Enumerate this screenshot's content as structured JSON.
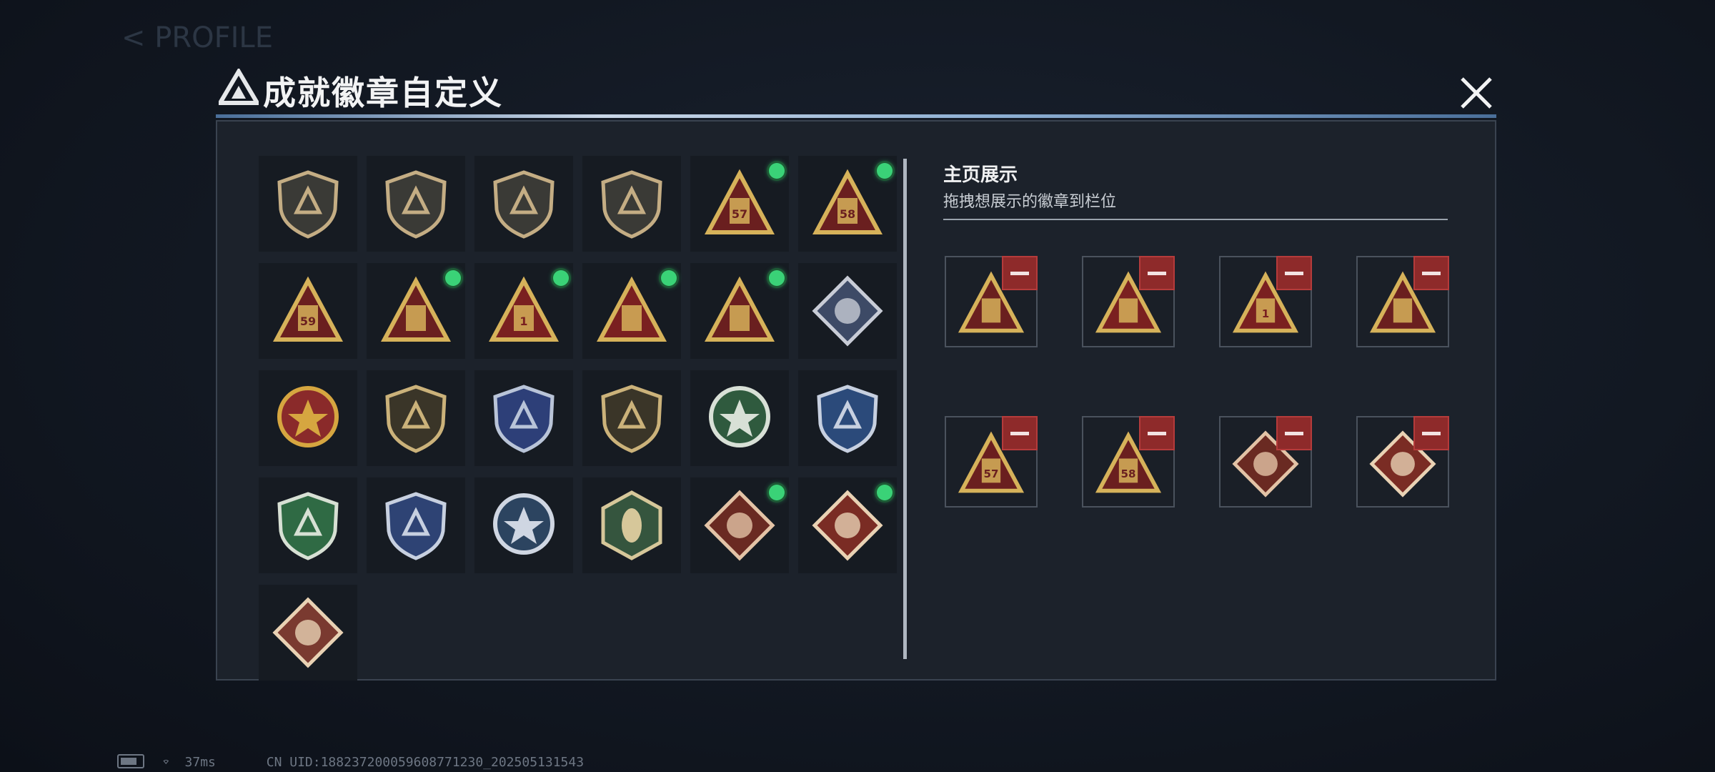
{
  "background": {
    "ghost_header": "< PROFILE"
  },
  "modal": {
    "title": "成就徽章自定义",
    "close_label": "×"
  },
  "badges": [
    {
      "name": "badge-logo-shield",
      "style": "shield",
      "color": "#c4ad84",
      "base": "#3a3a36",
      "selected": false
    },
    {
      "name": "badge-helicopter-shield",
      "style": "shield",
      "color": "#c4ad84",
      "base": "#3a3a36",
      "selected": false
    },
    {
      "name": "badge-emblem-shield",
      "style": "shield",
      "color": "#c4ad84",
      "base": "#3a3a36",
      "selected": false
    },
    {
      "name": "badge-blade-shield",
      "style": "shield",
      "color": "#c4ad84",
      "base": "#3a3a36",
      "selected": false
    },
    {
      "name": "badge-triangle-57",
      "style": "triangle",
      "color": "#d6b25a",
      "base": "#6a1f1f",
      "label": "57",
      "selected": true
    },
    {
      "name": "badge-triangle-58",
      "style": "triangle",
      "color": "#d6b25a",
      "base": "#6a1f1f",
      "label": "58",
      "selected": true
    },
    {
      "name": "badge-triangle-wings-59",
      "style": "triangle",
      "color": "#d6b25a",
      "base": "#6a1f1f",
      "label": "59",
      "selected": false
    },
    {
      "name": "badge-triangle-rockets",
      "style": "triangle",
      "color": "#d6b25a",
      "base": "#6a1f1f",
      "selected": true
    },
    {
      "name": "badge-triangle-number-1",
      "style": "triangle",
      "color": "#d6b25a",
      "base": "#7a2020",
      "label": "1",
      "selected": true
    },
    {
      "name": "badge-triangle-tower",
      "style": "triangle",
      "color": "#d6b25a",
      "base": "#7a2020",
      "selected": true
    },
    {
      "name": "badge-triangle-soldiers",
      "style": "triangle",
      "color": "#d6b25a",
      "base": "#6a1f1f",
      "selected": true
    },
    {
      "name": "badge-diamond-silver",
      "style": "diamond",
      "color": "#c8ccd6",
      "base": "#3d4a66",
      "selected": false
    },
    {
      "name": "badge-star-medal",
      "style": "circle",
      "color": "#d6a640",
      "base": "#8a2a2a",
      "selected": false
    },
    {
      "name": "badge-chevron-shield",
      "style": "shield",
      "color": "#cbb27a",
      "base": "#3a3528",
      "selected": false
    },
    {
      "name": "badge-blue-winged-shield",
      "style": "shield",
      "color": "#b9c4d8",
      "base": "#2d3f78",
      "selected": false
    },
    {
      "name": "badge-d20-shield",
      "style": "shield",
      "color": "#cbb27a",
      "base": "#3a3528",
      "selected": false
    },
    {
      "name": "badge-green-rose",
      "style": "circle",
      "color": "#d8e0d6",
      "base": "#2f5a3e",
      "selected": false
    },
    {
      "name": "badge-blue-rifle-shield",
      "style": "shield",
      "color": "#c7d0e0",
      "base": "#2b4a7a",
      "selected": false
    },
    {
      "name": "badge-green-rifle-shield",
      "style": "shield",
      "color": "#d7e0d4",
      "base": "#2f6a44",
      "selected": false
    },
    {
      "name": "badge-blue-knife-shield",
      "style": "shield",
      "color": "#c7d0e0",
      "base": "#2e4374",
      "selected": false
    },
    {
      "name": "badge-eagle-circle",
      "style": "circle",
      "color": "#cfd6e2",
      "base": "#2c4460",
      "selected": false
    },
    {
      "name": "badge-hornet-hexagon",
      "style": "hexagon",
      "color": "#d6c79a",
      "base": "#35553e",
      "selected": false
    },
    {
      "name": "badge-dragon-diamond",
      "style": "diamond",
      "color": "#e3c3a6",
      "base": "#6a2a22",
      "selected": true
    },
    {
      "name": "badge-runner-diamond",
      "style": "diamond",
      "color": "#e9d2b4",
      "base": "#7a2c24",
      "selected": true
    },
    {
      "name": "badge-lizard-diamond",
      "style": "diamond",
      "color": "#e9d2b4",
      "base": "#7a3a30",
      "selected": false
    }
  ],
  "showcase": {
    "title": "主页展示",
    "subtitle": "拖拽想展示的徽章到栏位",
    "slots": [
      {
        "name": "slot-soldiers",
        "style": "triangle",
        "color": "#d6b25a",
        "base": "#6a1f1f"
      },
      {
        "name": "slot-tower",
        "style": "triangle",
        "color": "#d6b25a",
        "base": "#7a2020"
      },
      {
        "name": "slot-number-1",
        "style": "triangle",
        "color": "#d6b25a",
        "base": "#7a2020",
        "label": "1"
      },
      {
        "name": "slot-rockets",
        "style": "triangle",
        "color": "#d6b25a",
        "base": "#6a1f1f"
      },
      {
        "name": "slot-triangle-57",
        "style": "triangle",
        "color": "#d6b25a",
        "base": "#6a1f1f",
        "label": "57"
      },
      {
        "name": "slot-triangle-58",
        "style": "triangle",
        "color": "#d6b25a",
        "base": "#6a1f1f",
        "label": "58"
      },
      {
        "name": "slot-dragon",
        "style": "diamond",
        "color": "#e3c3a6",
        "base": "#6a2a22"
      },
      {
        "name": "slot-runner",
        "style": "diamond",
        "color": "#e9d2b4",
        "base": "#7a2c24"
      }
    ]
  },
  "status": {
    "ping": "37ms",
    "uid": "CN UID:188237200059608771230_202505131543"
  }
}
